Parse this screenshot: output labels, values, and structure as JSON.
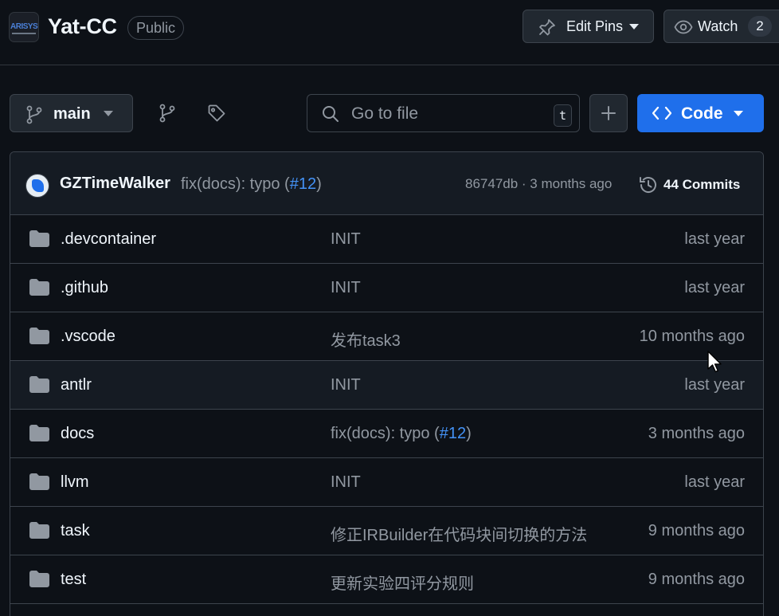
{
  "header": {
    "repo_name": "Yat-CC",
    "visibility_badge": "Public",
    "org_avatar_text": "ARISYSU",
    "edit_pins_label": "Edit Pins",
    "watch_label": "Watch",
    "watch_count": "2"
  },
  "toolbar": {
    "branch_name": "main",
    "search_placeholder": "Go to file",
    "search_shortcut": "t",
    "code_label": "Code"
  },
  "latest_commit": {
    "author": "GZTimeWalker",
    "message_prefix": "fix(docs): typo (",
    "message_link": "#12",
    "message_suffix": ")",
    "hash_and_time": "86747db · 3 months ago",
    "commits_label": "44 Commits"
  },
  "files": [
    {
      "name": ".devcontainer",
      "msg_prefix": "INIT",
      "msg_link": "",
      "msg_suffix": "",
      "date": "last year"
    },
    {
      "name": ".github",
      "msg_prefix": "INIT",
      "msg_link": "",
      "msg_suffix": "",
      "date": "last year"
    },
    {
      "name": ".vscode",
      "msg_prefix": "发布task3",
      "msg_link": "",
      "msg_suffix": "",
      "date": "10 months ago"
    },
    {
      "name": "antlr",
      "msg_prefix": "INIT",
      "msg_link": "",
      "msg_suffix": "",
      "date": "last year"
    },
    {
      "name": "docs",
      "msg_prefix": "fix(docs): typo (",
      "msg_link": "#12",
      "msg_suffix": ")",
      "date": "3 months ago"
    },
    {
      "name": "llvm",
      "msg_prefix": "INIT",
      "msg_link": "",
      "msg_suffix": "",
      "date": "last year"
    },
    {
      "name": "task",
      "msg_prefix": "修正IRBuilder在代码块间切换的方法",
      "msg_link": "",
      "msg_suffix": "",
      "date": "9 months ago"
    },
    {
      "name": "test",
      "msg_prefix": "更新实验四评分规则",
      "msg_link": "",
      "msg_suffix": "",
      "date": "9 months ago"
    }
  ],
  "colors": {
    "background": "#0d1117",
    "accent": "#1f6feb",
    "link": "#4493f8",
    "folder": "#9198a1"
  }
}
